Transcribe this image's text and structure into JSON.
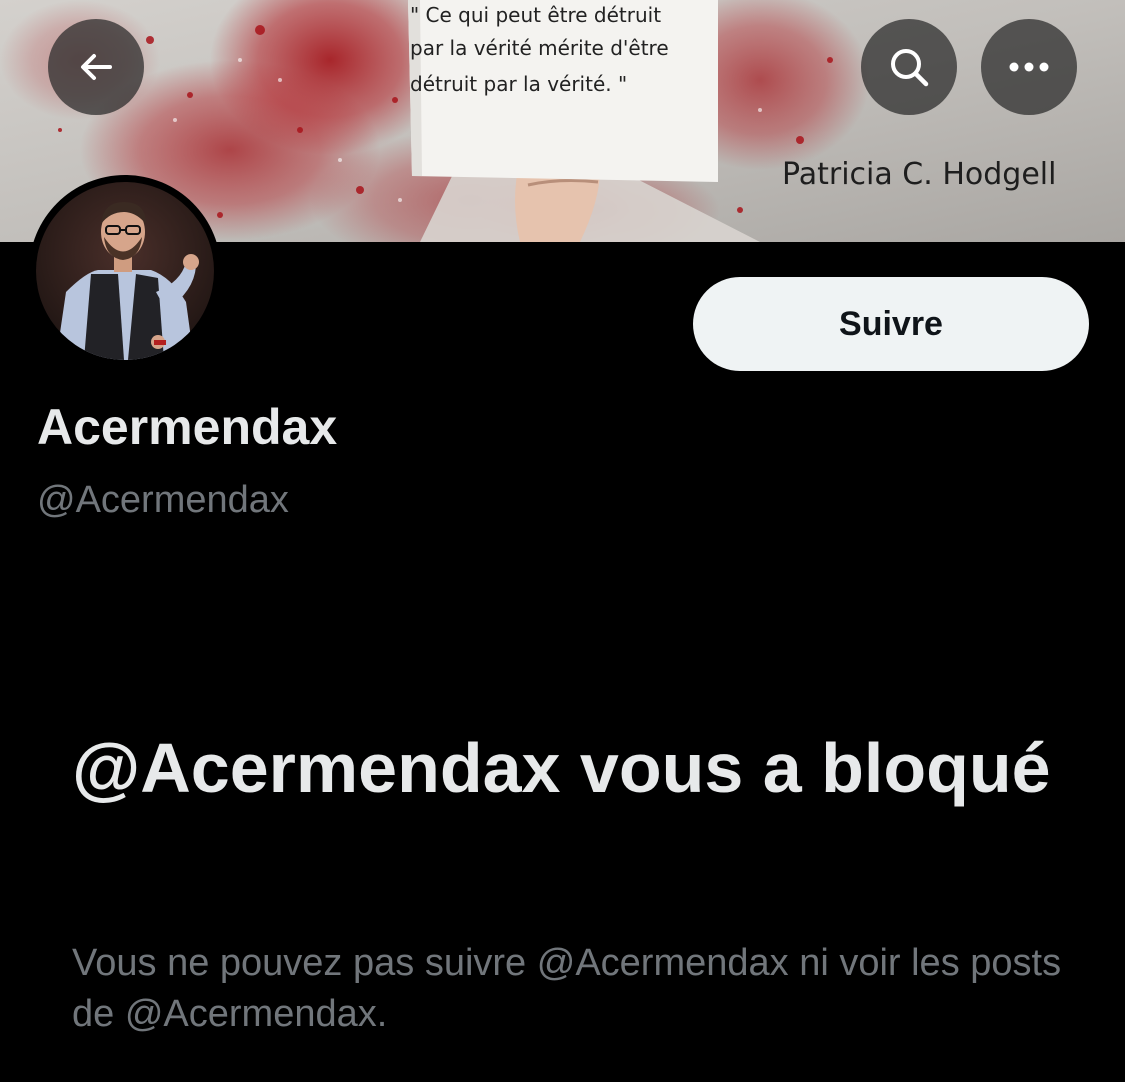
{
  "banner": {
    "quote_lines": [
      "\" Ce qui peut être détruit",
      "par la vérité mérite d'être",
      "détruit par la vérité. \""
    ],
    "author": "Patricia C. Hodgell"
  },
  "header": {
    "back_icon": "arrow-left-icon",
    "search_icon": "search-icon",
    "more_icon": "more-horizontal-icon"
  },
  "profile": {
    "display_name": "Acermendax",
    "handle": "@Acermendax",
    "follow_label": "Suivre"
  },
  "blocked": {
    "title": "@Acermendax vous a bloqué",
    "description": "Vous ne pouvez pas suivre @Acermendax ni voir les posts de @Acermendax."
  },
  "colors": {
    "background": "#000000",
    "primary_text": "#e7e9ea",
    "secondary_text": "#71767b",
    "follow_button_bg": "#eff3f4",
    "follow_button_text": "#0f1419",
    "overlay_button_bg": "#282828"
  }
}
